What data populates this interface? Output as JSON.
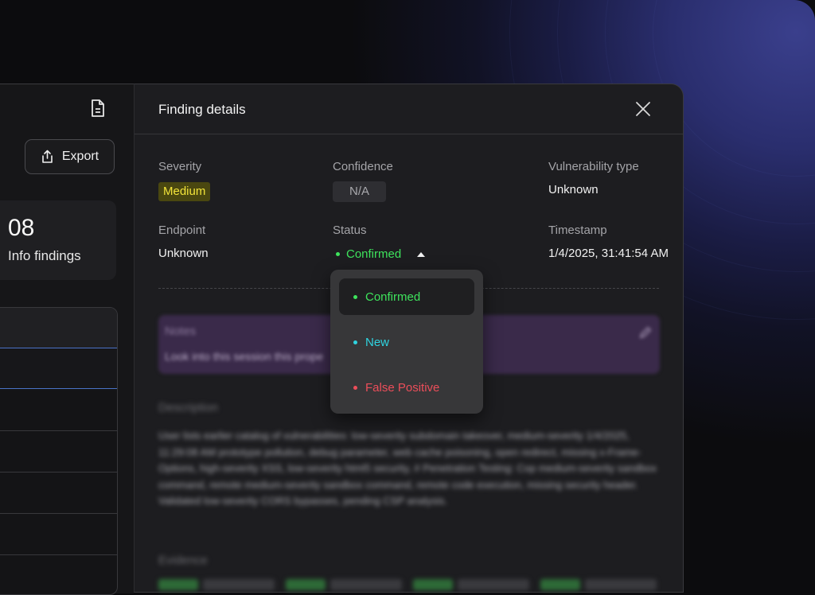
{
  "left_panel": {
    "export_label": "Export",
    "stat_value": "08",
    "stat_label": "Info findings"
  },
  "modal": {
    "title": "Finding details",
    "fields": {
      "severity": {
        "label": "Severity",
        "value": "Medium"
      },
      "confidence": {
        "label": "Confidence",
        "value": "N/A"
      },
      "vulnerability_type": {
        "label": "Vulnerability type",
        "value": "Unknown"
      },
      "endpoint": {
        "label": "Endpoint",
        "value": "Unknown"
      },
      "status": {
        "label": "Status",
        "value": "Confirmed"
      },
      "timestamp": {
        "label": "Timestamp",
        "value": "1/4/2025, 31:41:54 AM"
      }
    },
    "notes": {
      "title": "Notes",
      "text": "Look into this session this prope"
    },
    "description": {
      "title": "Description",
      "text": "User lists earlier catalog of vulnerabilities: low-severity subdomain takeover, medium-severity 1/4/2025, 11:29:08 AM prototype pollution, debug parameter, web cache poisoning, open redirect, missing x-Frame-Options, high-severity XSS, low-severity html5 security, # Penetration Testing: Cop medium-severity sandbox command, remote medium-severity sandbox command, remote code execution, missing security header. Validated low-severity CORS bypasses, pending CSP analysis."
    },
    "evidence": {
      "title": "Evidence"
    }
  },
  "status_dropdown": {
    "options": [
      {
        "label": "Confirmed",
        "color": "#3ee35c",
        "selected": true
      },
      {
        "label": "New",
        "color": "#2fd4e0",
        "selected": false
      },
      {
        "label": "False Positive",
        "color": "#ec4e5a",
        "selected": false
      }
    ]
  },
  "colors": {
    "severity_medium": "#f3e43a",
    "status_confirmed": "#3ee35c",
    "status_new": "#2fd4e0",
    "status_false_positive": "#ec4e5a",
    "selection_accent": "#4a73c8"
  }
}
